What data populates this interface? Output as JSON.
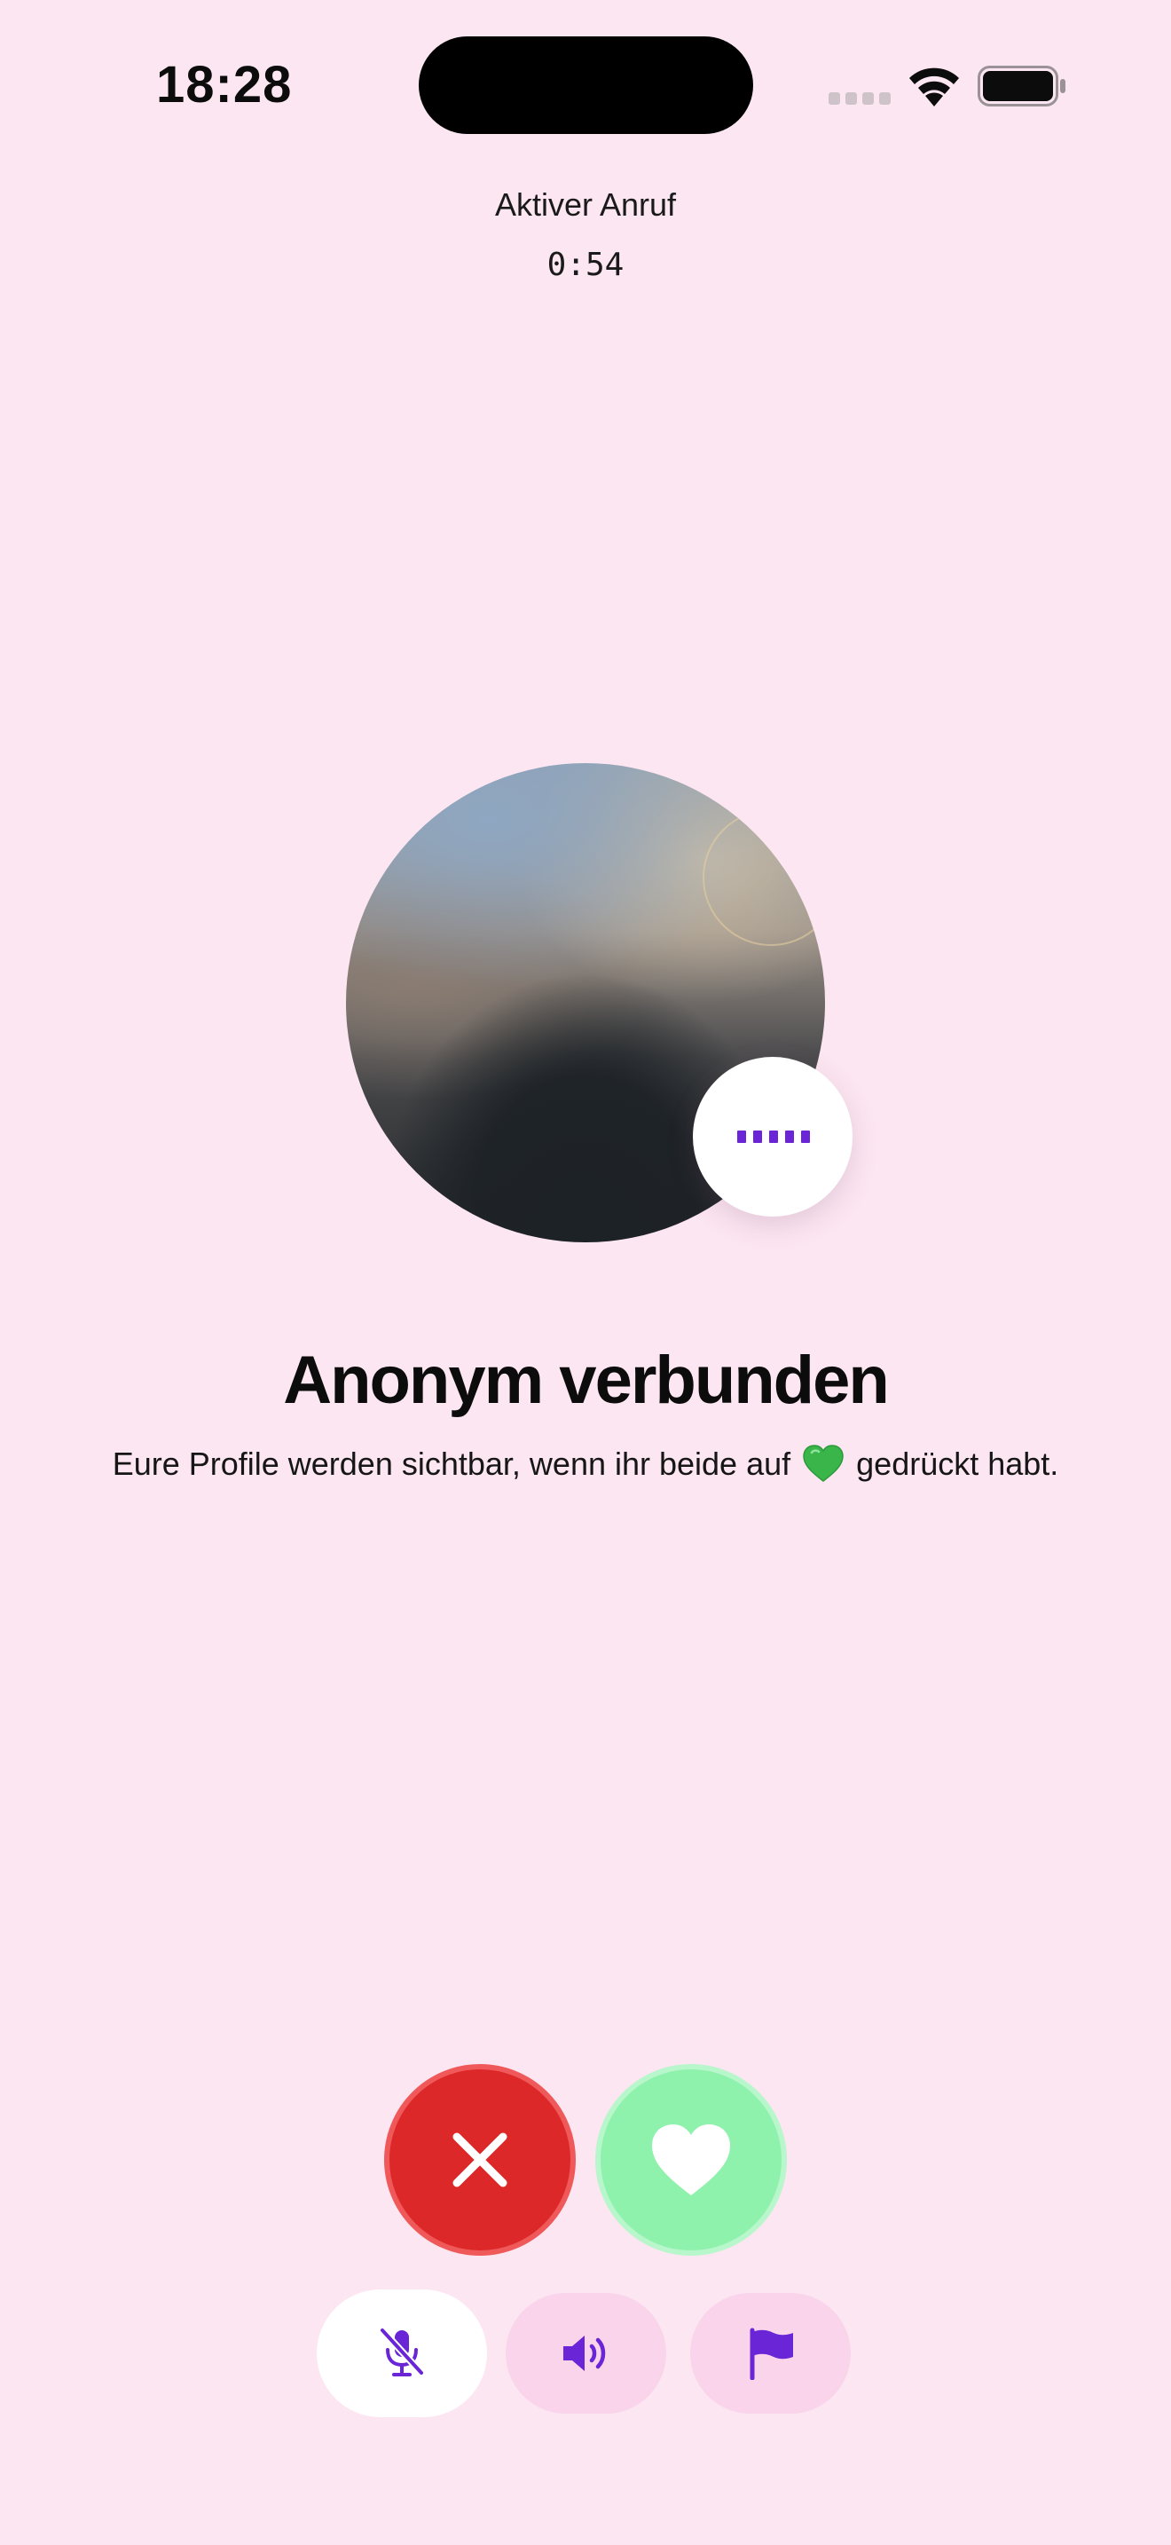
{
  "status_bar": {
    "time": "18:28",
    "icons": [
      "cellular-signal-icon",
      "wifi-icon",
      "battery-icon"
    ]
  },
  "call": {
    "title": "Aktiver Anruf",
    "timer": "0:54"
  },
  "partner": {
    "avatar": "blurred-profile-photo",
    "typing_indicator_icon": "typing-dots-icon"
  },
  "main": {
    "headline": "Anonym verbunden",
    "subline_before": "Eure Profile werden sichtbar, wenn ihr beide auf",
    "subline_after": "gedrückt habt.",
    "subline_emoji": "green-heart-icon"
  },
  "actions": {
    "decline_icon": "close-icon",
    "like_icon": "heart-icon",
    "mute_icon": "microphone-off-icon",
    "speaker_icon": "speaker-icon",
    "report_icon": "flag-icon"
  },
  "colors": {
    "background": "#fce6f1",
    "accent_purple": "#6a25d6",
    "decline_red": "#dc2828",
    "like_green": "#8ef1ac",
    "control_pink": "#f9d4ea"
  }
}
